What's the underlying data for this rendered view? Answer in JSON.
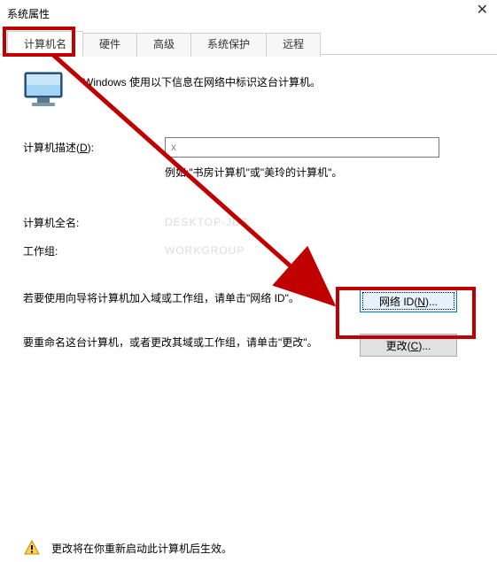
{
  "window": {
    "title": "系统属性"
  },
  "tabs": {
    "computer_name": "计算机名",
    "hardware": "硬件",
    "advanced": "高级",
    "system_protection": "系统保护",
    "remote": "远程"
  },
  "intro": "Windows 使用以下信息在网络中标识这台计算机。",
  "fields": {
    "description_label_pre": "计算机描述(",
    "description_label_key": "D",
    "description_label_post": "):",
    "description_value": "x",
    "description_hint": "例如:\"书房计算机\"或\"美玲的计算机\"。",
    "fullname_label": "计算机全名:",
    "fullname_value": "DESKTOP-JDS",
    "workgroup_label": "工作组:",
    "workgroup_value": "WORKGROUP"
  },
  "actions": {
    "network_id_text": "若要使用向导将计算机加入域或工作组，请单击\"网络 ID\"。",
    "network_id_btn_pre": "网络 ID(",
    "network_id_btn_key": "N",
    "network_id_btn_post": ")...",
    "change_text": "要重命名这台计算机，或者更改其域或工作组，请单击\"更改\"。",
    "change_btn_pre": "更改(",
    "change_btn_key": "C",
    "change_btn_post": ")..."
  },
  "footer": {
    "text": "更改将在你重新启动此计算机后生效。"
  }
}
